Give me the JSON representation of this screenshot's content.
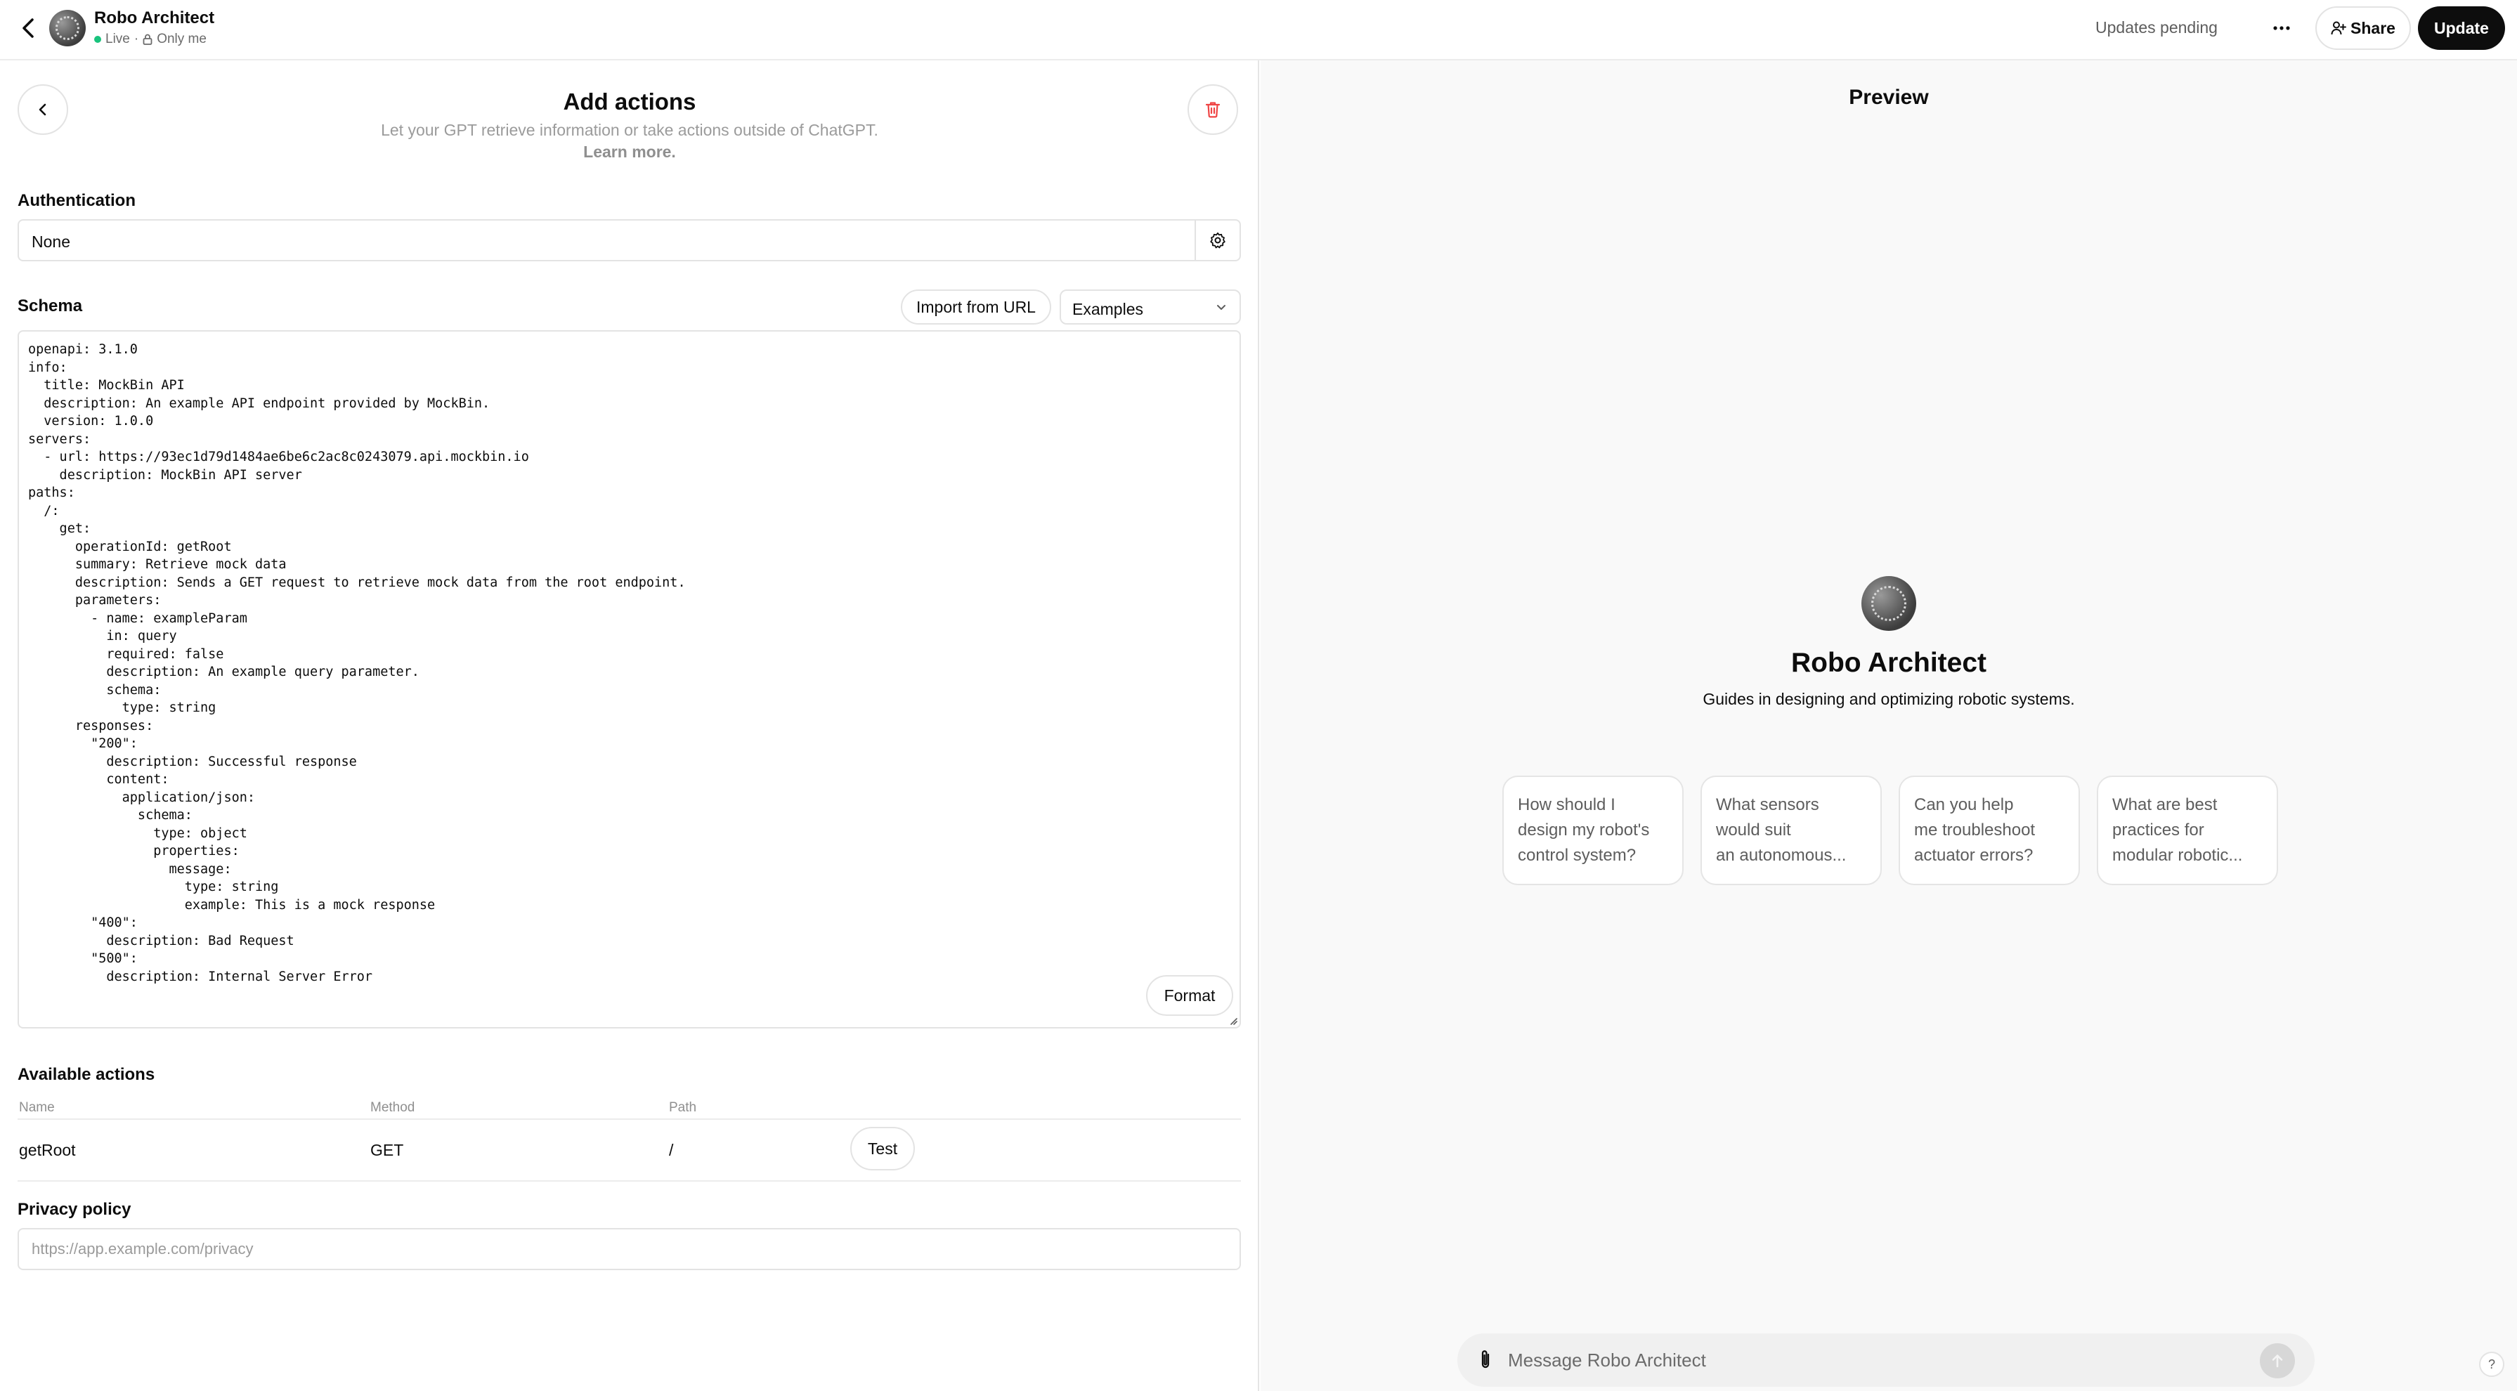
{
  "header": {
    "gpt_name": "Robo Architect",
    "status_live": "Live",
    "status_separator": "·",
    "visibility": "Only me",
    "updates_status": "Updates pending",
    "share_label": "Share",
    "update_label": "Update"
  },
  "editor": {
    "title": "Add actions",
    "subtitle": "Let your GPT retrieve information or take actions outside of ChatGPT.",
    "learn_more": "Learn more.",
    "authentication": {
      "label": "Authentication",
      "value": "None"
    },
    "schema": {
      "label": "Schema",
      "import_label": "Import from URL",
      "examples_label": "Examples",
      "format_label": "Format",
      "code": "openapi: 3.1.0\ninfo:\n  title: MockBin API\n  description: An example API endpoint provided by MockBin.\n  version: 1.0.0\nservers:\n  - url: https://93ec1d79d1484ae6be6c2ac8c0243079.api.mockbin.io\n    description: MockBin API server\npaths:\n  /:\n    get:\n      operationId: getRoot\n      summary: Retrieve mock data\n      description: Sends a GET request to retrieve mock data from the root endpoint.\n      parameters:\n        - name: exampleParam\n          in: query\n          required: false\n          description: An example query parameter.\n          schema:\n            type: string\n      responses:\n        \"200\":\n          description: Successful response\n          content:\n            application/json:\n              schema:\n                type: object\n                properties:\n                  message:\n                    type: string\n                    example: This is a mock response\n        \"400\":\n          description: Bad Request\n        \"500\":\n          description: Internal Server Error"
    },
    "available_actions": {
      "label": "Available actions",
      "columns": {
        "name": "Name",
        "method": "Method",
        "path": "Path"
      },
      "rows": [
        {
          "name": "getRoot",
          "method": "GET",
          "path": "/",
          "test_label": "Test"
        }
      ]
    },
    "privacy": {
      "label": "Privacy policy",
      "value": "",
      "placeholder": "https://app.example.com/privacy"
    }
  },
  "preview": {
    "title": "Preview",
    "gpt_name": "Robo Architect",
    "description": "Guides in designing and optimizing robotic systems.",
    "starters": [
      "How should I\ndesign my robot's\ncontrol system?",
      "What sensors\nwould suit\nan autonomous...",
      "Can you help\nme troubleshoot\nactuator errors?",
      "What are best\npractices for\nmodular robotic..."
    ],
    "composer_placeholder": "Message Robo Architect",
    "help_label": "?"
  },
  "icons": {
    "back": "chevron-left-icon",
    "lock": "lock-icon",
    "more": "more-horizontal-icon",
    "share": "person-plus-icon",
    "delete": "trash-icon",
    "settings": "gear-icon",
    "dropdown": "chevron-down-icon",
    "attach": "paperclip-icon",
    "send": "arrow-up-icon"
  },
  "colors": {
    "live": "#19c37d",
    "delete": "#ef4444",
    "primary_button": "#0d0d0d"
  }
}
